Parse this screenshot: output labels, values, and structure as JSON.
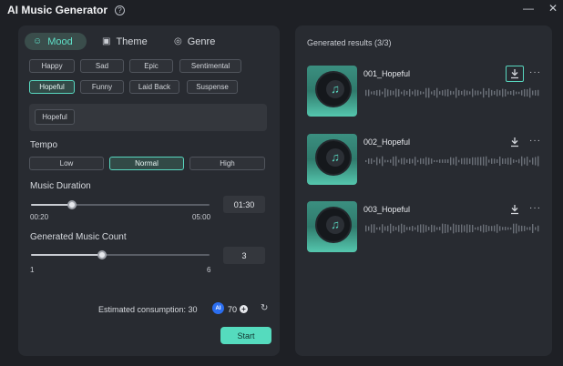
{
  "window": {
    "title": "AI Music Generator",
    "help_icon": "?",
    "minimize_icon": "—",
    "close_icon": "✕"
  },
  "tabs": [
    {
      "label": "Mood",
      "icon": "mood-icon",
      "active": true
    },
    {
      "label": "Theme",
      "icon": "theme-icon",
      "active": false
    },
    {
      "label": "Genre",
      "icon": "genre-icon",
      "active": false
    }
  ],
  "mood_options": [
    "Happy",
    "Sad",
    "Epic",
    "Sentimental",
    "Hopeful",
    "Funny",
    "Laid Back",
    "Suspense"
  ],
  "selected_mood": "Hopeful",
  "selected_chip": "Hopeful",
  "tempo": {
    "label": "Tempo",
    "options": [
      "Low",
      "Normal",
      "High"
    ],
    "selected": "Normal"
  },
  "duration": {
    "label": "Music Duration",
    "min": "00:20",
    "max": "05:00",
    "value": "01:30",
    "level": 0.23
  },
  "count": {
    "label": "Generated Music Count",
    "min": "1",
    "max": "6",
    "value": "3",
    "level": 0.4
  },
  "consumption": {
    "label": "Estimated consumption: 30",
    "badge": "AI",
    "credits": "70",
    "plus_icon": "+",
    "refresh_icon": "↻"
  },
  "start_label": "Start",
  "results": {
    "title": "Generated results (3/3)",
    "items": [
      {
        "name": "001_Hopeful",
        "download_active": true
      },
      {
        "name": "002_Hopeful",
        "download_active": false
      },
      {
        "name": "003_Hopeful",
        "download_active": false
      }
    ],
    "note_icon": "♫",
    "more_icon": "···"
  },
  "colors": {
    "accent": "#55dbbe",
    "panel": "#282b31",
    "background": "#1e2025"
  }
}
